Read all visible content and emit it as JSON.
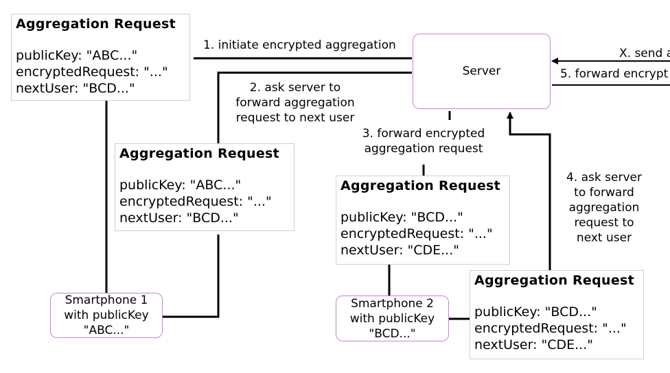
{
  "boxes": [
    {
      "title": "Aggregation Request",
      "publicKey": "publicKey: \"ABC...\"",
      "encryptedRequest": "encryptedRequest: \"...\"",
      "nextUser": "nextUser: \"BCD...\""
    },
    {
      "title": "Aggregation Request",
      "publicKey": "publicKey: \"ABC...\"",
      "encryptedRequest": "encryptedRequest: \"...\"",
      "nextUser": "nextUser: \"BCD...\""
    },
    {
      "title": "Aggregation Request",
      "publicKey": "publicKey: \"BCD...\"",
      "encryptedRequest": "encryptedRequest: \"...\"",
      "nextUser": "nextUser: \"CDE...\""
    },
    {
      "title": "Aggregation Request",
      "publicKey": "publicKey: \"BCD...\"",
      "encryptedRequest": "encryptedRequest: \"...\"",
      "nextUser": "nextUser: \"CDE...\""
    }
  ],
  "nodes": {
    "server": "Server",
    "smartphone1": {
      "line1": "Smartphone 1",
      "line2": "with publicKey",
      "line3": "\"ABC...\""
    },
    "smartphone2": {
      "line1": "Smartphone 2",
      "line2": "with publicKey",
      "line3": "\"BCD...\""
    }
  },
  "labels": {
    "step1": "1. initiate encrypted aggregation",
    "step2": {
      "line1": "2. ask server to",
      "line2": "forward aggregation",
      "line3": "request to next user"
    },
    "step3": {
      "line1": "3. forward encrypted",
      "line2": "aggregation request"
    },
    "step4": {
      "line1": "4. ask server",
      "line2": "to forward",
      "line3": "aggregation",
      "line4": "request to",
      "line5": "next user"
    },
    "stepX": "X. send a",
    "step5": "5. forward encrypt"
  },
  "colors": {
    "node_border": "#c285d0",
    "line": "#000000",
    "box_border": "#d0d0d0"
  }
}
